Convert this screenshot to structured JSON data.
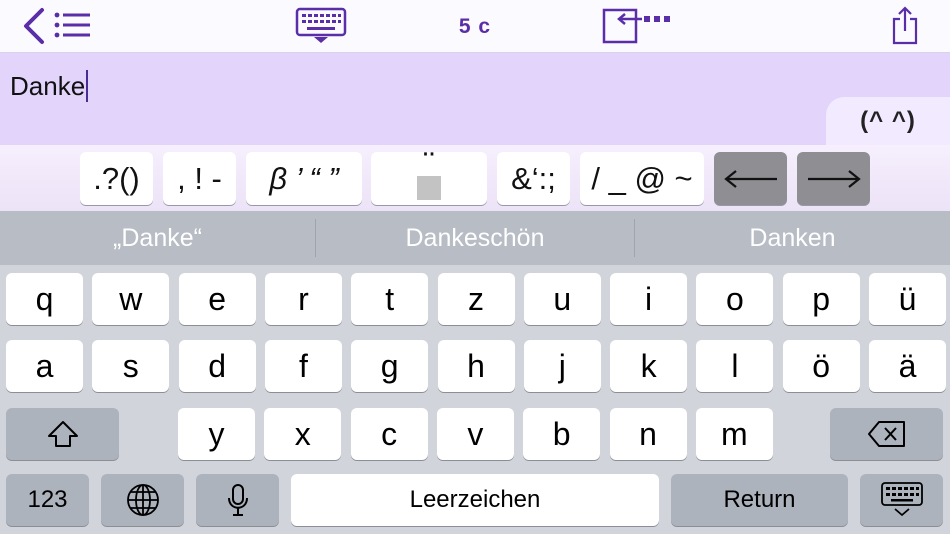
{
  "toolbar": {
    "back_icon": "chevron-left-icon",
    "list_icon": "list-icon",
    "keyboard_icon": "keyboard-dismiss-icon",
    "char_count": "5 c",
    "import_icon": "insert-arrow-icon",
    "share_icon": "share-icon"
  },
  "editor": {
    "text": "Danke",
    "kaomoji_tab": "(^ ^)"
  },
  "symbol_bar": {
    "keys": [
      ".?()",
      ", ! -",
      "β ’ “ ”",
      "¨",
      "&‘:;",
      "/ _ @ ~"
    ],
    "arrow_left_icon": "arrow-left-icon",
    "arrow_right_icon": "arrow-right-icon"
  },
  "predictions": [
    "„Danke“",
    "Dankeschön",
    "Danken"
  ],
  "keyboard": {
    "row1": [
      "q",
      "w",
      "e",
      "r",
      "t",
      "z",
      "u",
      "i",
      "o",
      "p",
      "ü"
    ],
    "row2": [
      "a",
      "s",
      "d",
      "f",
      "g",
      "h",
      "j",
      "k",
      "l",
      "ö",
      "ä"
    ],
    "row3": [
      "y",
      "x",
      "c",
      "v",
      "b",
      "n",
      "m"
    ],
    "numbers_label": "123",
    "space_label": "Leerzeichen",
    "return_label": "Return",
    "shift_icon": "shift-icon",
    "delete_icon": "delete-icon",
    "globe_icon": "globe-icon",
    "mic_icon": "microphone-icon",
    "dismiss_icon": "keyboard-dismiss-icon"
  },
  "colors": {
    "accent": "#5a2ea6",
    "editor_bg": "#e2d4fa",
    "keyboard_bg": "#d1d4db",
    "function_key_bg": "#adb3bd"
  }
}
